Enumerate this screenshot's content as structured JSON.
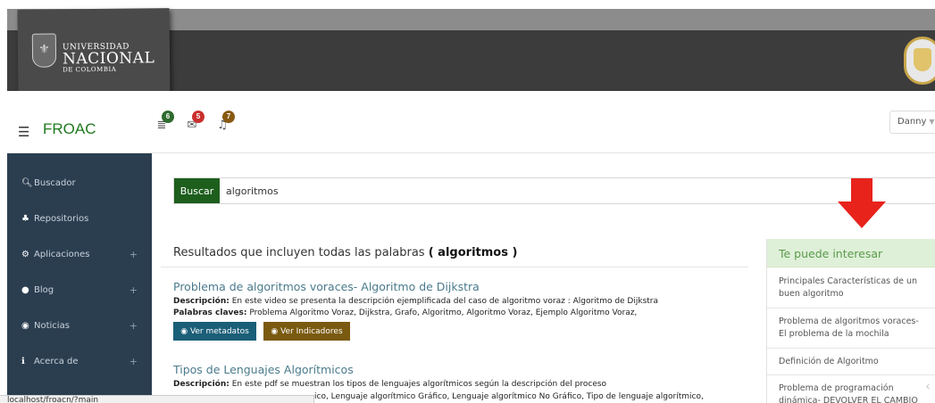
{
  "header": {
    "logo": {
      "line1": "UNIVERSIDAD",
      "line2": "NACIONAL",
      "line3": "DE COLOMBIA"
    }
  },
  "nav": {
    "brand": "FROAC",
    "badges": {
      "tasks": "6",
      "messages": "5",
      "notifications": "7"
    },
    "user": "Danny"
  },
  "sidebar": {
    "items": [
      {
        "label": "Buscador",
        "icon": "search-icon",
        "expandable": false
      },
      {
        "label": "Repositorios",
        "icon": "sitemap-icon",
        "expandable": false
      },
      {
        "label": "Aplicaciones",
        "icon": "gears-icon",
        "expandable": true
      },
      {
        "label": "Blog",
        "icon": "comment-icon",
        "expandable": true
      },
      {
        "label": "Noticias",
        "icon": "rss-icon",
        "expandable": true
      },
      {
        "label": "Acerca de",
        "icon": "info-icon",
        "expandable": true
      }
    ]
  },
  "search": {
    "button": "Buscar",
    "value": "algoritmos"
  },
  "results": {
    "heading": "Resultados que incluyen todas las palabras",
    "query": "( algoritmos )",
    "items": [
      {
        "title": "Problema de algoritmos voraces- Algoritmo de Dijkstra",
        "desc_label": "Descripción:",
        "desc": "En este video se presenta la descripción ejemplificada del caso de algoritmo voraz : Algoritmo de Dijkstra",
        "kw_label": "Palabras claves:",
        "kw": "Problema Algoritmo Voraz, Dijkstra, Grafo, Algoritmo, Algoritmo Voraz, Ejemplo Algoritmo Voraz,",
        "btn_meta": "Ver metadatos",
        "btn_ind": "Ver Indicadores"
      },
      {
        "title": "Tipos de Lenguajes Algorítmicos",
        "desc_label": "Descripción:",
        "desc": "En este pdf se muestran los tipos de lenguajes algorítmicos según la descripción del proceso",
        "kw_visible": "ico, Lenguaje algorítmico Gráfico, Lenguaje algorítmico No Gráfico, Tipo de lenguaje algorítmico,"
      }
    ]
  },
  "interest": {
    "heading": "Te puede interesar",
    "items": [
      "Principales Características de un buen algoritmo",
      "Problema de algoritmos voraces- El problema de la mochila",
      "Definición de Algoritmo",
      "Problema de programación dinámica- DEVOLVER EL CAMBIO"
    ]
  },
  "status_bar": "localhost/froacn/?main",
  "colors": {
    "brand_green": "#1f7a1f",
    "sidebar_bg": "#2b3e50",
    "header_dark": "#3c3c3c",
    "arrow_red": "#e8231c"
  }
}
